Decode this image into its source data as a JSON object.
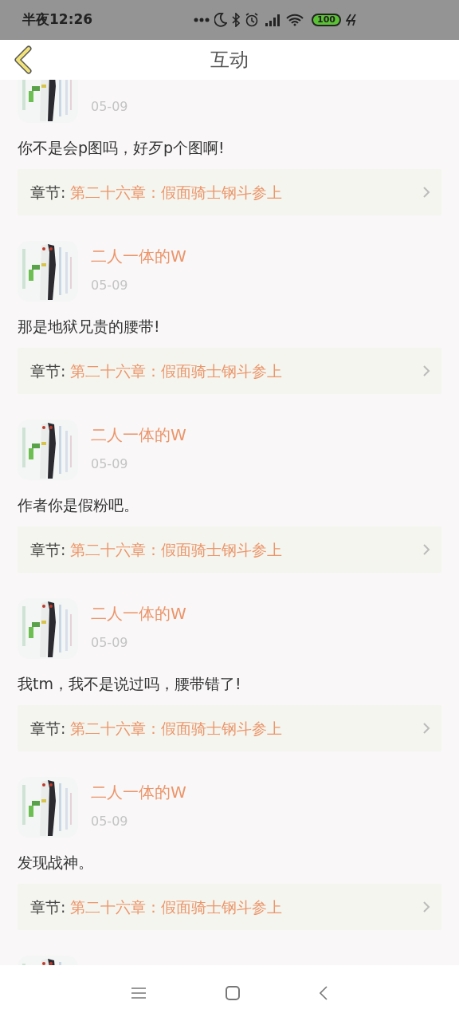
{
  "status_bar": {
    "time": "半夜12:26",
    "battery": "100"
  },
  "header": {
    "title": "互动"
  },
  "comments": [
    {
      "kind": "comment",
      "date": "05-09",
      "text": "你不是会p图吗，好歹p个图啊!",
      "chapter_label": "章节:",
      "chapter": "第二十六章：假面骑士钢斗参上"
    },
    {
      "kind": "comment",
      "name": "二人一体的W",
      "date": "05-09",
      "text": "那是地狱兄贵的腰带!",
      "chapter_label": "章节:",
      "chapter": "第二十六章：假面骑士钢斗参上"
    },
    {
      "kind": "comment",
      "name": "二人一体的W",
      "date": "05-09",
      "text": "作者你是假粉吧。",
      "chapter_label": "章节:",
      "chapter": "第二十六章：假面骑士钢斗参上"
    },
    {
      "kind": "comment",
      "name": "二人一体的W",
      "date": "05-09",
      "text": "我tm，我不是说过吗，腰带错了!",
      "chapter_label": "章节:",
      "chapter": "第二十六章：假面骑士钢斗参上"
    },
    {
      "kind": "comment",
      "name": "二人一体的W",
      "date": "05-09",
      "text": "发现战神。",
      "chapter_label": "章节:",
      "chapter": "第二十六章：假面骑士钢斗参上"
    },
    {
      "kind": "partial"
    }
  ]
}
